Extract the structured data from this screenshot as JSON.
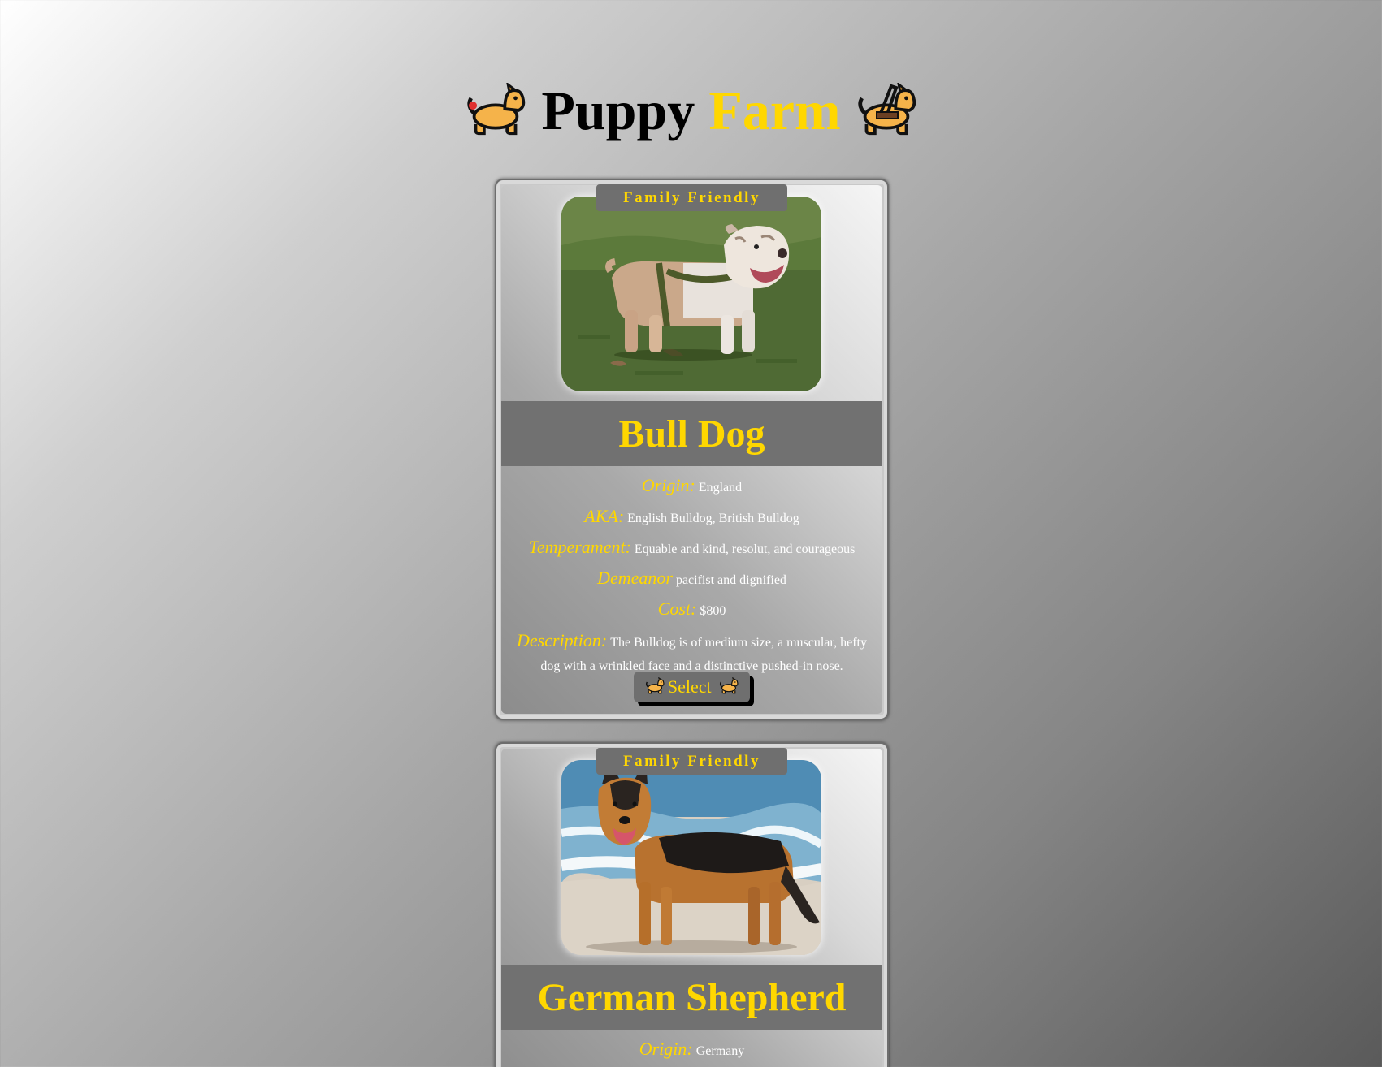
{
  "header": {
    "title_part1": "Puppy",
    "title_part2": "Farm",
    "left_icon": "dog-icon",
    "right_icon": "guide-dog-icon"
  },
  "colors": {
    "accent": "#ffd700",
    "panel": "#717171"
  },
  "cards": [
    {
      "badge": "Family Friendly",
      "photo": "bulldog-photo",
      "name": "Bull Dog",
      "origin_label": "Origin:",
      "origin": "England",
      "aka_label": "AKA:",
      "aka": "English Bulldog, British Bulldog",
      "temperament_label": "Temperament:",
      "temperament": "Equable and kind, resolut, and courageous",
      "demeanor_label": "Demeanor",
      "demeanor": "pacifist and dignified",
      "cost_label": "Cost:",
      "cost": "$800",
      "description_label": "Description:",
      "description": "The Bulldog is of medium size, a muscular, hefty dog with a wrinkled face and a distinctive pushed-in nose.",
      "select_label": "Select"
    },
    {
      "badge": "Family Friendly",
      "photo": "german-shepherd-photo",
      "name": "German Shepherd",
      "origin_label": "Origin:",
      "origin": "Germany"
    }
  ]
}
